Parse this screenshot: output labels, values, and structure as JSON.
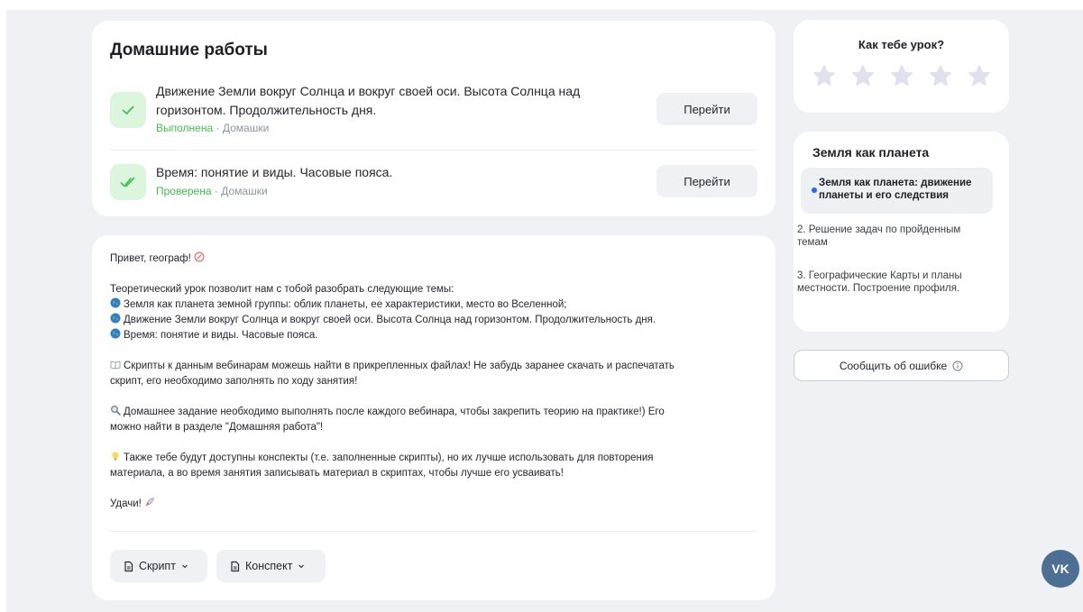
{
  "homework": {
    "title": "Домашние работы",
    "items": [
      {
        "name": "Движение Земли вокруг Солнца и вокруг своей оси. Высота Солнца над горизонтом. Продолжительность дня.",
        "status": "Выполнена",
        "separator": "·",
        "category": "Домашки",
        "button": "Перейти"
      },
      {
        "name": "Время: понятие и виды. Часовые пояса.",
        "status": "Проверена",
        "separator": "·",
        "category": "Домашки",
        "button": "Перейти"
      }
    ]
  },
  "description": {
    "greeting": "Привет, географ!",
    "intro": "Теоретический урок позволит нам с тобой разобрать следующие темы:",
    "topics": [
      "Земля как планета земной группы: облик планеты, ее характеристики, место во Вселенной;",
      "Движение Земли вокруг Солнца и вокруг своей оси. Высота Солнца над горизонтом. Продолжительность дня.",
      "Время: понятие и виды. Часовые пояса."
    ],
    "scripts_line1": "Скрипты к данным вебинарам можешь найти в прикрепленных файлах! Не забудь заранее скачать и распечатать",
    "scripts_line2": "скрипт, его необходимо заполнять по ходу занятия!",
    "homework_line1": "Домашнее задание необходимо выполнять после каждого вебинара, чтобы закрепить теорию на практике!) Его",
    "homework_line2": "можно найти в разделе \"Домашняя работа\"!",
    "notes_line1": "Также тебе будут доступны конспекты (т.е. заполненные скрипты), но их лучше использовать для повторения",
    "notes_line2": "материала, а во время занятия записывать материал в скриптах, чтобы лучше его усваивать!",
    "farewell": "Удачи!",
    "script_button": "Скрипт",
    "notes_button": "Конспект"
  },
  "rating": {
    "title": "Как тебе урок?",
    "max_stars": 5,
    "value": 0
  },
  "topic_nav": {
    "title": "Земля как планета",
    "items": [
      "Земля как планета: движение планеты и его следствия",
      "2. Решение задач по пройденным темам",
      "3. Географические Карты и планы местности. Построение профиля."
    ]
  },
  "report_button": "Сообщить об ошибке",
  "vk_label": "VK",
  "colors": {
    "background": "#f0f1f4",
    "success": "#42c152",
    "accent": "#1f6bf2",
    "vk": "#4d6f94",
    "star_empty": "#dfe2ec"
  }
}
